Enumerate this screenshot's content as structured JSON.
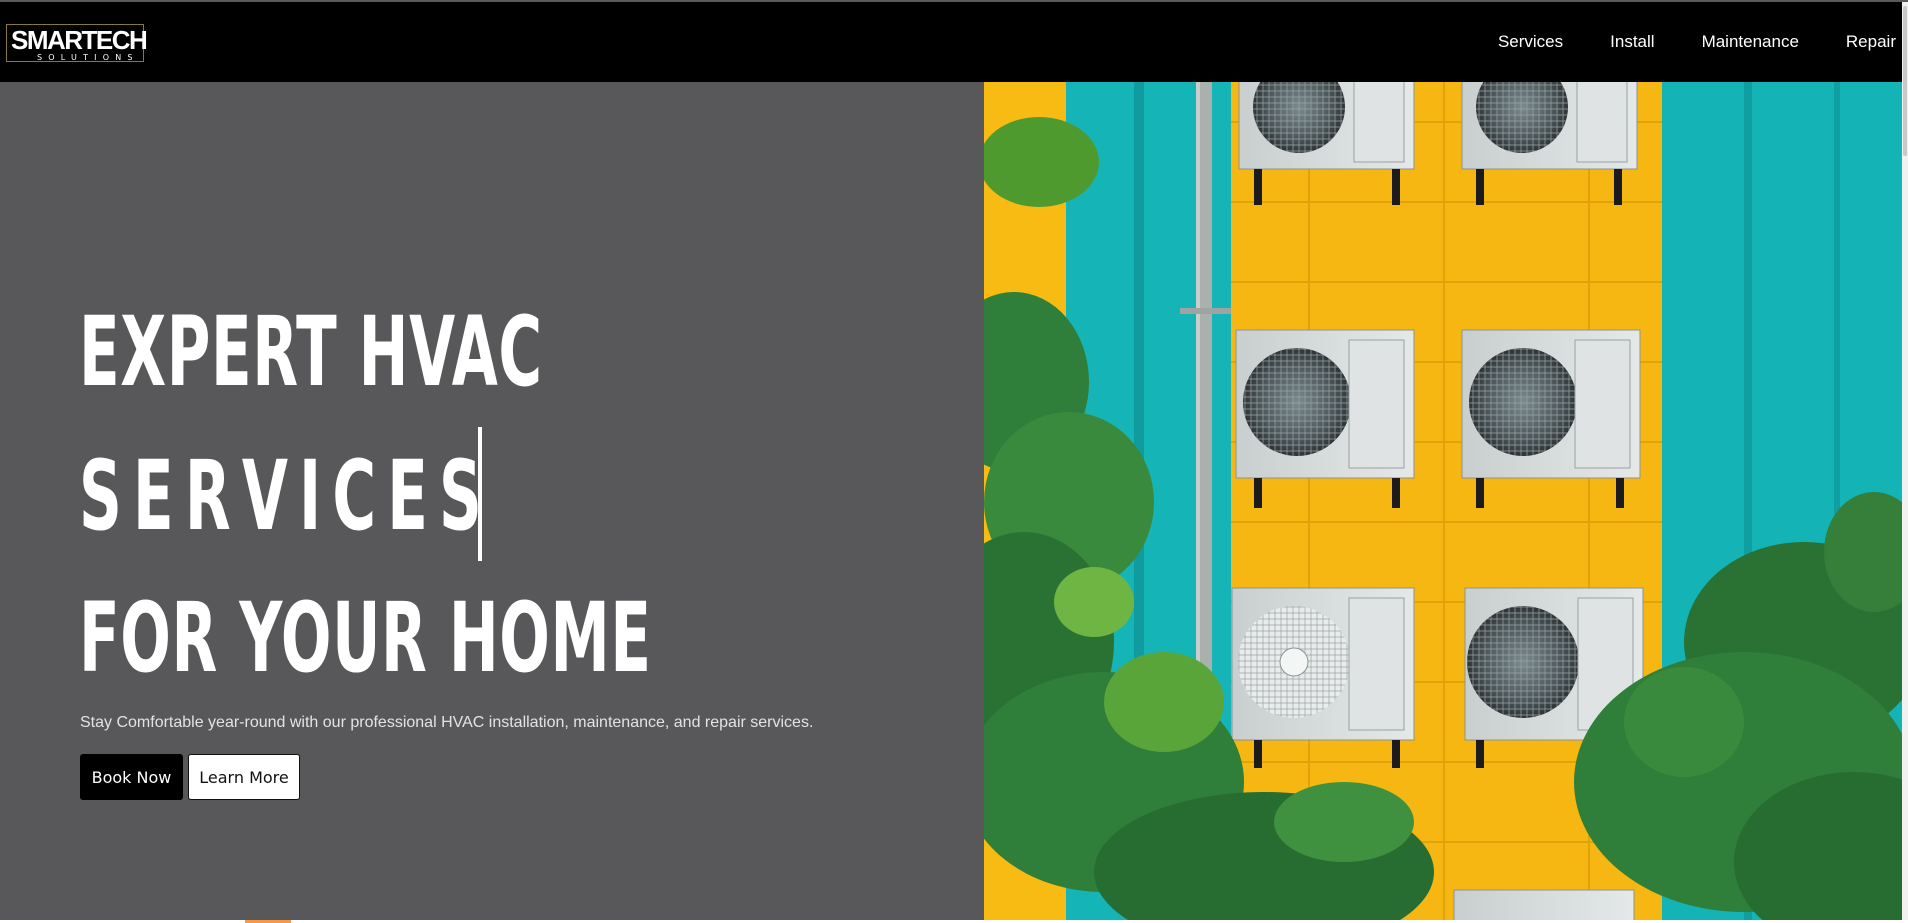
{
  "brand": {
    "logo_main": "SMARTECH",
    "logo_sub": "SOLUTIONS",
    "logo_border_color": "#8a7a2e"
  },
  "nav": {
    "items": [
      {
        "label": "Services"
      },
      {
        "label": "Install"
      },
      {
        "label": "Maintenance"
      },
      {
        "label": "Repair"
      }
    ]
  },
  "hero": {
    "line1": "EXPERT HVAC",
    "line2": "SERVICES",
    "line3": "FOR YOUR HOME",
    "subtitle": "Stay Comfortable year-round with our professional HVAC installation, maintenance, and repair services.",
    "primary_button": "Book Now",
    "secondary_button": "Learn More",
    "background_color": "#58585a"
  },
  "image": {
    "subject": "air-conditioner-units-on-colorful-wall",
    "colors": {
      "yellow": "#f8b80f",
      "teal": "#13b8b8",
      "leaf": "#2f7a3a"
    }
  }
}
